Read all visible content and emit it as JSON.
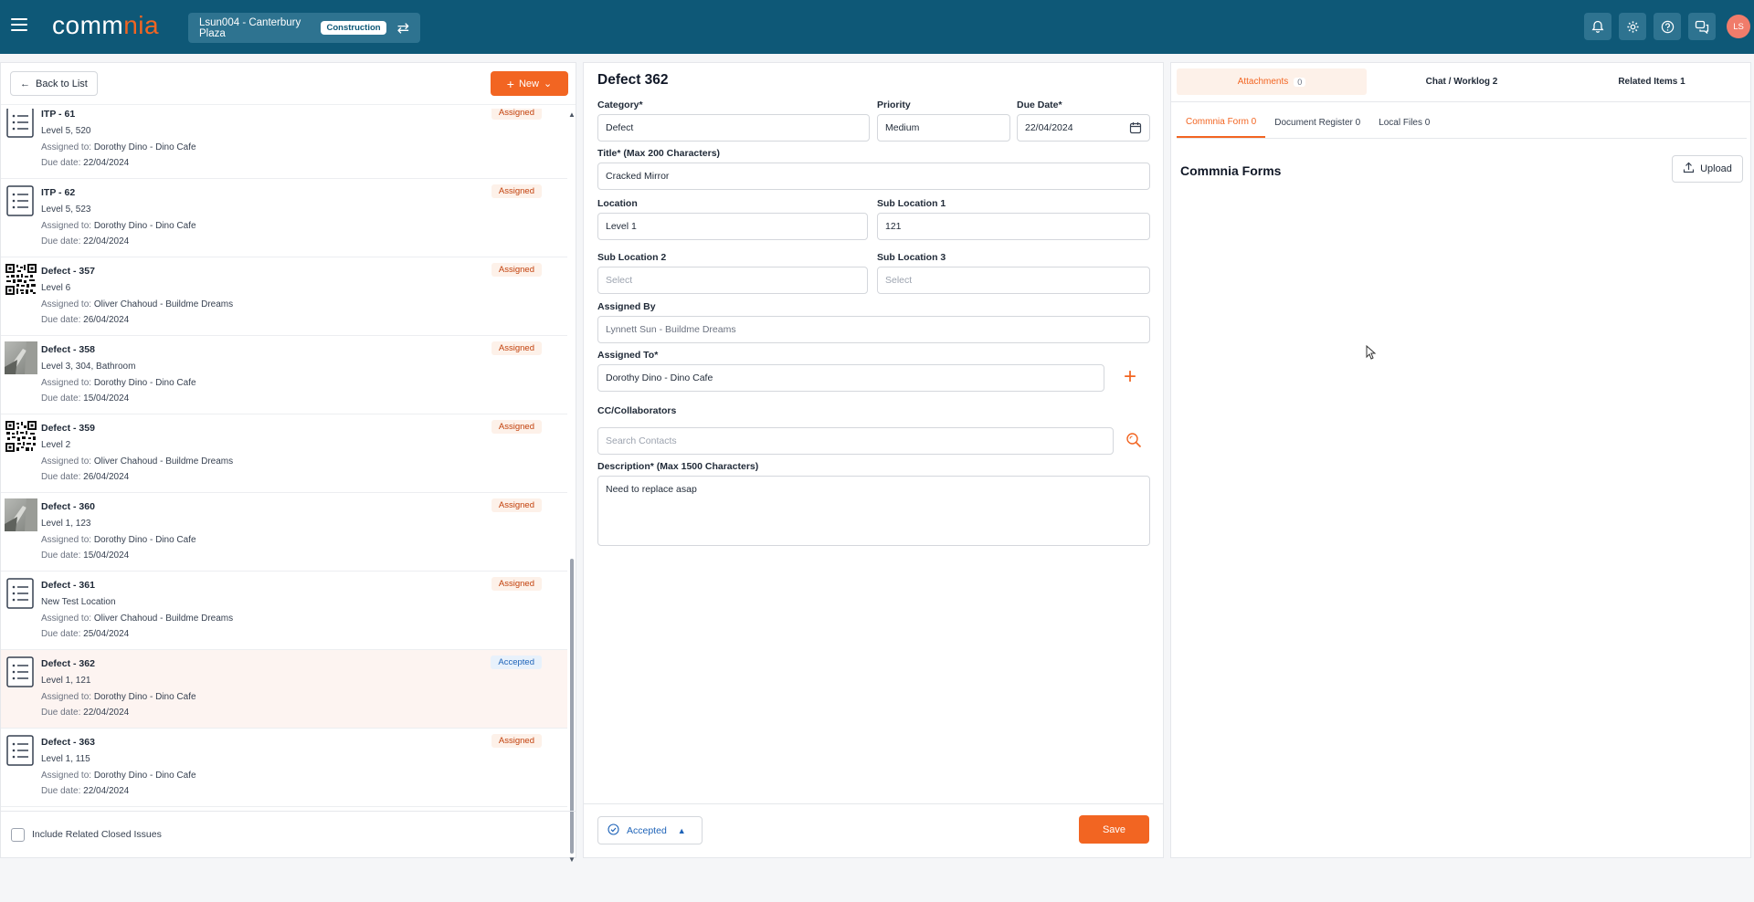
{
  "header": {
    "logo_prefix": "comm",
    "logo_accent": "nia",
    "project_name": "Lsun004 - Canterbury Plaza",
    "project_type": "Construction",
    "avatar_initials": "LS"
  },
  "left": {
    "back_label": "Back to List",
    "new_label": "New",
    "include_closed_label": "Include Related Closed Issues",
    "items": [
      {
        "title": "ITP - 61",
        "location": "Level 5, 520",
        "assigned_label": "Assigned to:",
        "assigned_to": "Dorothy Dino - Dino Cafe",
        "due_label": "Due date:",
        "due": "22/04/2024",
        "status": "Assigned",
        "thumb": "list-icon"
      },
      {
        "title": "ITP - 62",
        "location": "Level 5, 523",
        "assigned_label": "Assigned to:",
        "assigned_to": "Dorothy Dino - Dino Cafe",
        "due_label": "Due date:",
        "due": "22/04/2024",
        "status": "Assigned",
        "thumb": "list-icon"
      },
      {
        "title": "Defect - 357",
        "location": "Level 6",
        "assigned_label": "Assigned to:",
        "assigned_to": "Oliver Chahoud - Buildme Dreams",
        "due_label": "Due date:",
        "due": "26/04/2024",
        "status": "Assigned",
        "thumb": "qr-code-image"
      },
      {
        "title": "Defect - 358",
        "location": "Level 3, 304, Bathroom",
        "assigned_label": "Assigned to:",
        "assigned_to": "Dorothy Dino - Dino Cafe",
        "due_label": "Due date:",
        "due": "15/04/2024",
        "status": "Assigned",
        "thumb": "photo-image"
      },
      {
        "title": "Defect - 359",
        "location": "Level 2",
        "assigned_label": "Assigned to:",
        "assigned_to": "Oliver Chahoud - Buildme Dreams",
        "due_label": "Due date:",
        "due": "26/04/2024",
        "status": "Assigned",
        "thumb": "qr-code-image"
      },
      {
        "title": "Defect - 360",
        "location": "Level 1, 123",
        "assigned_label": "Assigned to:",
        "assigned_to": "Dorothy Dino - Dino Cafe",
        "due_label": "Due date:",
        "due": "15/04/2024",
        "status": "Assigned",
        "thumb": "photo-image"
      },
      {
        "title": "Defect - 361",
        "location": "New Test Location",
        "assigned_label": "Assigned to:",
        "assigned_to": "Oliver Chahoud - Buildme Dreams",
        "due_label": "Due date:",
        "due": "25/04/2024",
        "status": "Assigned",
        "thumb": "list-icon"
      },
      {
        "title": "Defect - 362",
        "location": "Level 1, 121",
        "assigned_label": "Assigned to:",
        "assigned_to": "Dorothy Dino - Dino Cafe",
        "due_label": "Due date:",
        "due": "22/04/2024",
        "status": "Accepted",
        "thumb": "list-icon"
      },
      {
        "title": "Defect - 363",
        "location": "Level 1, 115",
        "assigned_label": "Assigned to:",
        "assigned_to": "Dorothy Dino - Dino Cafe",
        "due_label": "Due date:",
        "due": "22/04/2024",
        "status": "Assigned",
        "thumb": "list-icon"
      }
    ]
  },
  "form": {
    "title": "Defect 362",
    "category_label": "Category*",
    "category_value": "Defect",
    "priority_label": "Priority",
    "priority_value": "Medium",
    "due_label": "Due Date*",
    "due_value": "22/04/2024",
    "title_label": "Title* (Max 200 Characters)",
    "title_value": "Cracked Mirror",
    "location_label": "Location",
    "location_value": "Level 1",
    "sub1_label": "Sub Location 1",
    "sub1_value": "121",
    "sub2_label": "Sub Location 2",
    "sub2_placeholder": "Select",
    "sub3_label": "Sub Location 3",
    "sub3_placeholder": "Select",
    "assigned_by_label": "Assigned By",
    "assigned_by_value": "Lynnett Sun - Buildme Dreams",
    "assigned_to_label": "Assigned To*",
    "assigned_to_value": "Dorothy Dino - Dino Cafe",
    "cc_label": "CC/Collaborators",
    "cc_placeholder": "Search Contacts",
    "desc_label": "Description* (Max 1500 Characters)",
    "desc_value": "Need to replace asap",
    "status_value": "Accepted",
    "save_label": "Save"
  },
  "right": {
    "tabs": [
      {
        "label": "Attachments",
        "count": "0"
      },
      {
        "label": "Chat / Worklog 2"
      },
      {
        "label": "Related Items 1"
      }
    ],
    "sub_tabs": [
      "Commnia Form 0",
      "Document Register 0",
      "Local Files 0"
    ],
    "forms_title": "Commnia Forms",
    "upload_label": "Upload"
  },
  "colors": {
    "brand": "#0e5877",
    "accent": "#f26522",
    "accepted": "#1e63b8"
  }
}
